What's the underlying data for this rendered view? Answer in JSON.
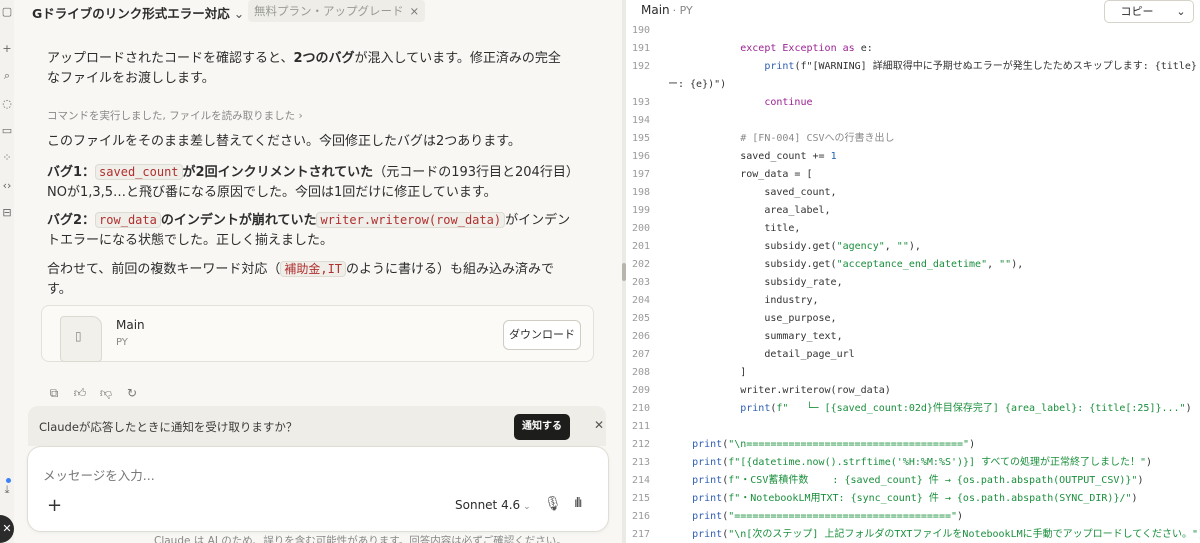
{
  "conversation": {
    "title": "Gドライブのリンク形式エラー対応",
    "plan_badge": "無料プラン・アップグレード",
    "intro": [
      "アップロードされたコードを確認すると、",
      "2つのバグ",
      "が混入しています。修正済みの完全",
      "なファイルをお渡しします。"
    ],
    "tool_summary": "コマンドを実行しました, ファイルを読み取りました",
    "replace_note": "このファイルをそのまま差し替えてください。今回修正したバグは2つあります。",
    "bug1": {
      "label": "バグ1：",
      "code": "saved_count",
      "bold": "が2回インクリメントされていた",
      "rest": "（元コードの193行目と204行目）",
      "line2": "NOが1,3,5…と飛び番になる原因でした。今回は1回だけに修正しています。"
    },
    "bug2": {
      "label": "バグ2：",
      "code": "row_data",
      "bold": "のインデントが崩れていた",
      "code2": "writer.writerow(row_data)",
      "rest": "がインデン",
      "line2": "トエラーになる状態でした。正しく揃えました。"
    },
    "extra": {
      "pre": "合わせて、前回の複数キーワード対応（",
      "code": "補助金,IT",
      "post": "のように書ける）も組み込み済みで",
      "line2": "す。"
    },
    "file_card": {
      "name": "Main",
      "type": "PY",
      "download": "ダウンロード"
    }
  },
  "notification": {
    "text": "Claudeが応答したときに通知を受け取りますか？",
    "button": "通知する"
  },
  "composer": {
    "placeholder": "メッセージを入力...",
    "model": "Sonnet 4.6"
  },
  "disclaimer": "Claude は AI のため、誤りを含む可能性があります。回答内容は必ずご確認ください。",
  "code_panel": {
    "title": "Main",
    "subtitle": "· PY",
    "copy_label": "コピー",
    "lines": [
      {
        "n": "190",
        "t": ""
      },
      {
        "n": "191",
        "t": "            except Exception as e:"
      },
      {
        "n": "192",
        "t": "                print(f\"[WARNING] 詳細取得中に予期せぬエラーが発生したためスキップします: {title} (エ"
      },
      {
        "n": "",
        "t": "ー: {e})\")"
      },
      {
        "n": "193",
        "t": "                continue"
      },
      {
        "n": "194",
        "t": ""
      },
      {
        "n": "195",
        "t": "            # [FN-004] CSVへの行書き出し"
      },
      {
        "n": "196",
        "t": "            saved_count += 1"
      },
      {
        "n": "197",
        "t": "            row_data = ["
      },
      {
        "n": "198",
        "t": "                saved_count,"
      },
      {
        "n": "199",
        "t": "                area_label,"
      },
      {
        "n": "200",
        "t": "                title,"
      },
      {
        "n": "201",
        "t": "                subsidy.get(\"agency\", \"\"),"
      },
      {
        "n": "202",
        "t": "                subsidy.get(\"acceptance_end_datetime\", \"\"),"
      },
      {
        "n": "203",
        "t": "                subsidy_rate,"
      },
      {
        "n": "204",
        "t": "                industry,"
      },
      {
        "n": "205",
        "t": "                use_purpose,"
      },
      {
        "n": "206",
        "t": "                summary_text,"
      },
      {
        "n": "207",
        "t": "                detail_page_url"
      },
      {
        "n": "208",
        "t": "            ]"
      },
      {
        "n": "209",
        "t": "            writer.writerow(row_data)"
      },
      {
        "n": "210",
        "t": "            print(f\"   └─ [{saved_count:02d}件目保存完了] {area_label}: {title[:25]}...\")"
      },
      {
        "n": "211",
        "t": ""
      },
      {
        "n": "212",
        "t": "    print(\"\\n====================================\")"
      },
      {
        "n": "213",
        "t": "    print(f\"[{datetime.now().strftime('%H:%M:%S')}] すべての処理が正常終了しました！\")"
      },
      {
        "n": "214",
        "t": "    print(f\"・CSV蓄積件数    : {saved_count} 件 → {os.path.abspath(OUTPUT_CSV)}\")"
      },
      {
        "n": "215",
        "t": "    print(f\"・NotebookLM用TXT: {sync_count} 件 → {os.path.abspath(SYNC_DIR)}/\")"
      },
      {
        "n": "216",
        "t": "    print(\"====================================\")"
      },
      {
        "n": "217",
        "t": "    print(\"\\n[次のステップ] 上記フォルダのTXTファイルをNotebookLMに手動でアップロードしてください。\")"
      }
    ]
  },
  "icons": [
    "sidebar-toggle-icon",
    "new-chat-icon",
    "search-icon",
    "chats-icon",
    "projects-icon",
    "artifacts-icon",
    "code-icon",
    "download-icon",
    "copy-icon",
    "thumbs-up-icon",
    "thumbs-down-icon",
    "retry-icon",
    "plus-icon",
    "mic-icon",
    "voice-icon",
    "close-icon",
    "chevron-down-icon",
    "file-icon"
  ]
}
